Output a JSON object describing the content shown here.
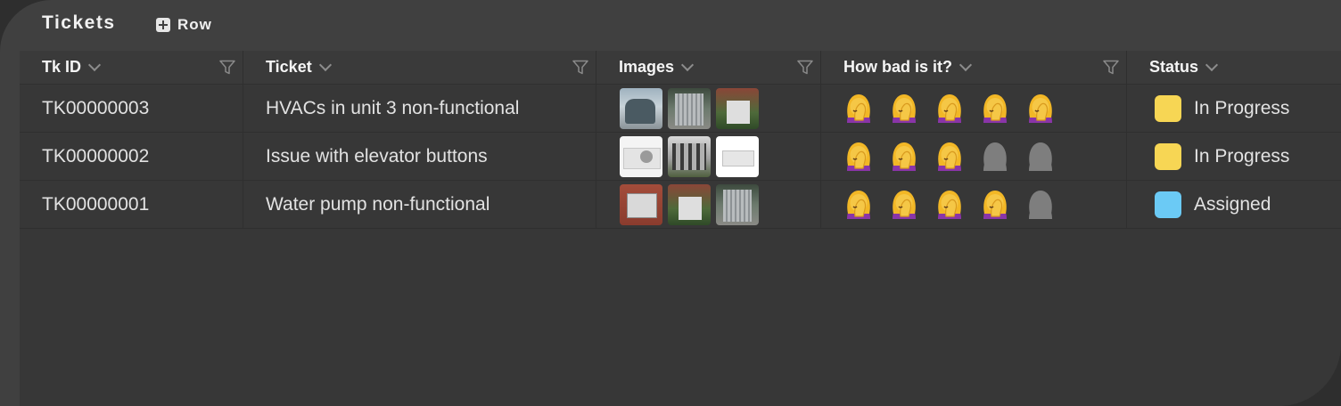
{
  "header": {
    "title": "Tickets",
    "add_row_label": "Row"
  },
  "columns": [
    {
      "label": "Tk ID"
    },
    {
      "label": "Ticket"
    },
    {
      "label": "Images"
    },
    {
      "label": "How bad is it?"
    },
    {
      "label": "Status"
    }
  ],
  "rows": [
    {
      "id": "TK00000003",
      "ticket": "HVACs in unit 3 non-functional",
      "images": [
        "hvac-unit",
        "condenser",
        "hedge-unit"
      ],
      "rating": 5,
      "rating_max": 5,
      "status": "In Progress",
      "status_color": "#f7d654"
    },
    {
      "id": "TK00000002",
      "ticket": "Issue with elevator buttons",
      "images": [
        "split-ac",
        "row-units",
        "wall-ac"
      ],
      "rating": 3,
      "rating_max": 5,
      "status": "In Progress",
      "status_color": "#f7d654"
    },
    {
      "id": "TK00000001",
      "ticket": "Water pump non-functional",
      "images": [
        "wall-ac-brick",
        "hedge-unit",
        "condenser"
      ],
      "rating": 4,
      "rating_max": 5,
      "status": "Assigned",
      "status_color": "#6bcaf5"
    }
  ],
  "rating_icons": {
    "active": "facepalm-woman-icon",
    "inactive": "person-silhouette-icon"
  },
  "colors": {
    "panel": "#404040",
    "grid": "#373737",
    "assigned": "#6bcaf5",
    "in_progress": "#f7d654"
  }
}
